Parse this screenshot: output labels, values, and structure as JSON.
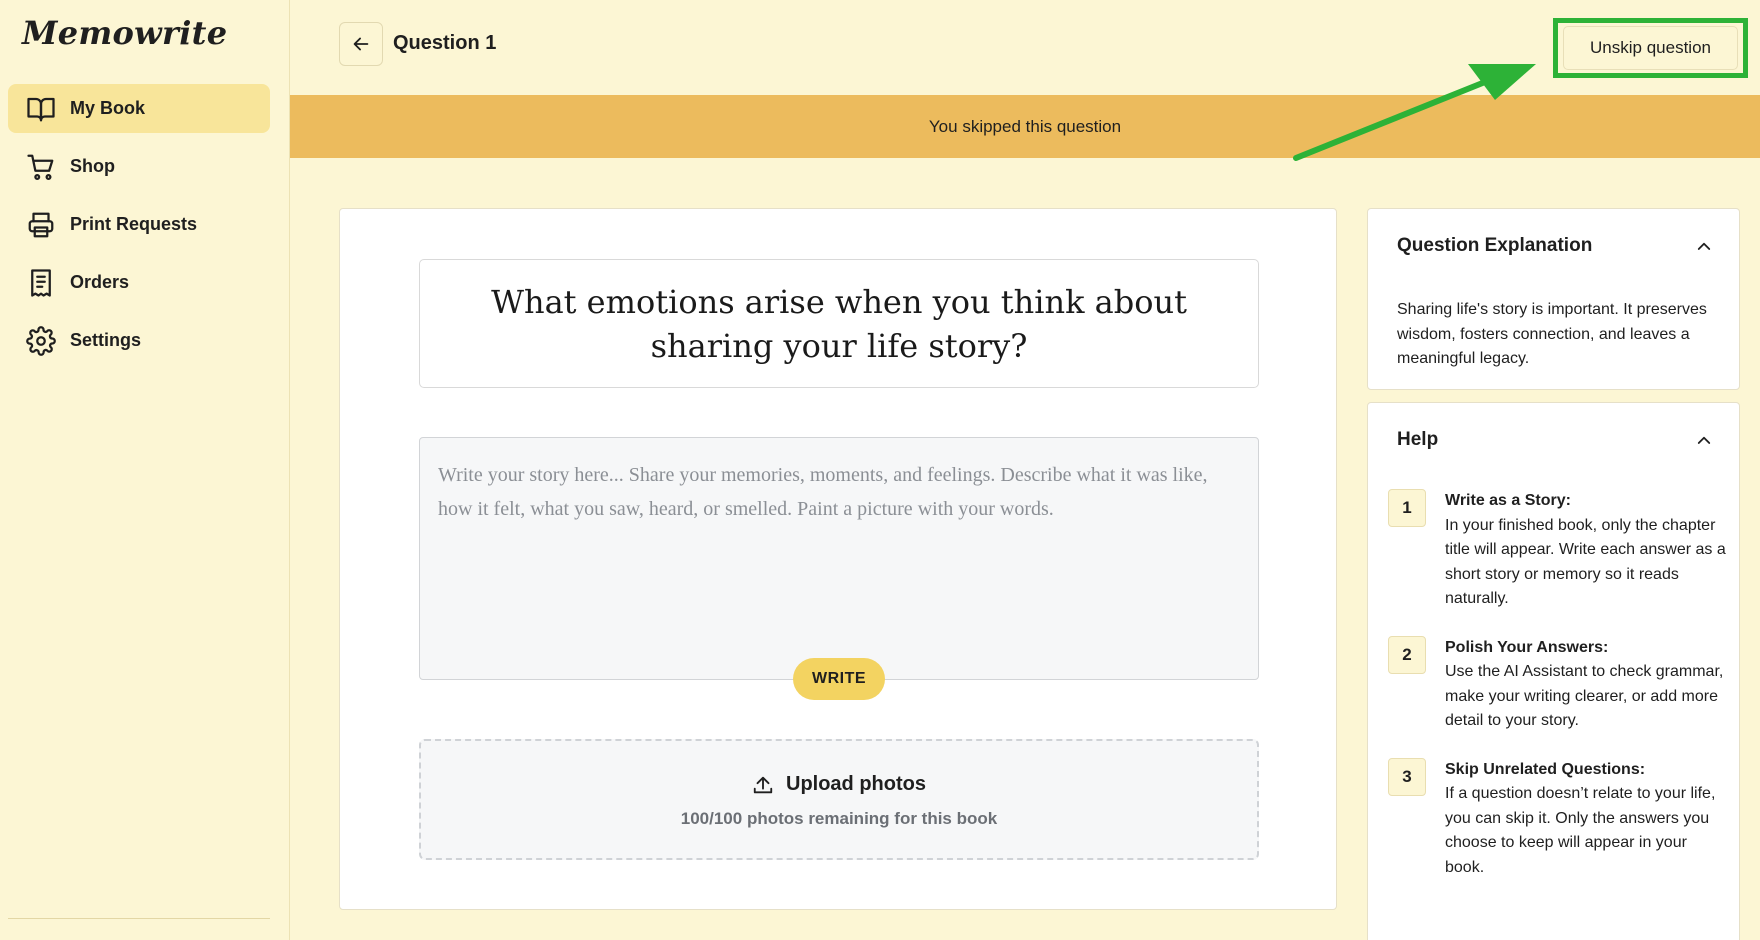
{
  "app": {
    "name": "Memowrite"
  },
  "sidebar": {
    "items": [
      {
        "label": "My Book",
        "icon": "book-open-icon",
        "active": true
      },
      {
        "label": "Shop",
        "icon": "cart-icon",
        "active": false
      },
      {
        "label": "Print Requests",
        "icon": "printer-icon",
        "active": false
      },
      {
        "label": "Orders",
        "icon": "receipt-icon",
        "active": false
      },
      {
        "label": "Settings",
        "icon": "gear-icon",
        "active": false
      }
    ]
  },
  "header": {
    "title": "Question 1",
    "unskip_label": "Unskip question"
  },
  "banner": {
    "text": "You skipped this question"
  },
  "main": {
    "question": "What emotions arise when you think about sharing your life story?",
    "story_placeholder": "Write your story here... Share your memories, moments, and feelings. Describe what it was like, how it felt, what you saw, heard, or smelled. Paint a picture with your words.",
    "story_value": "",
    "write_label": "WRITE",
    "upload": {
      "title": "Upload photos",
      "subtitle": "100/100 photos remaining for this book"
    }
  },
  "explanation": {
    "title": "Question Explanation",
    "text": "Sharing life's story is important. It preserves wisdom, fosters connection, and leaves a meaningful legacy."
  },
  "help": {
    "title": "Help",
    "items": [
      {
        "num": "1",
        "title": "Write as a Story:",
        "text": "In your finished book, only the chapter title will appear. Write each answer as a short story or memory so it reads naturally."
      },
      {
        "num": "2",
        "title": "Polish Your Answers:",
        "text": "Use the AI Assistant to check grammar, make your writing clearer, or add more detail to your story."
      },
      {
        "num": "3",
        "title": "Skip Unrelated Questions:",
        "text": "If a question doesn’t relate to your life, you can skip it. Only the answers you choose to keep will appear in your book."
      }
    ]
  },
  "colors": {
    "background": "#fcf6d4",
    "active_nav": "#f8e59a",
    "banner": "#ecbb5d",
    "write_button": "#f3d361",
    "highlight": "#2db237"
  }
}
